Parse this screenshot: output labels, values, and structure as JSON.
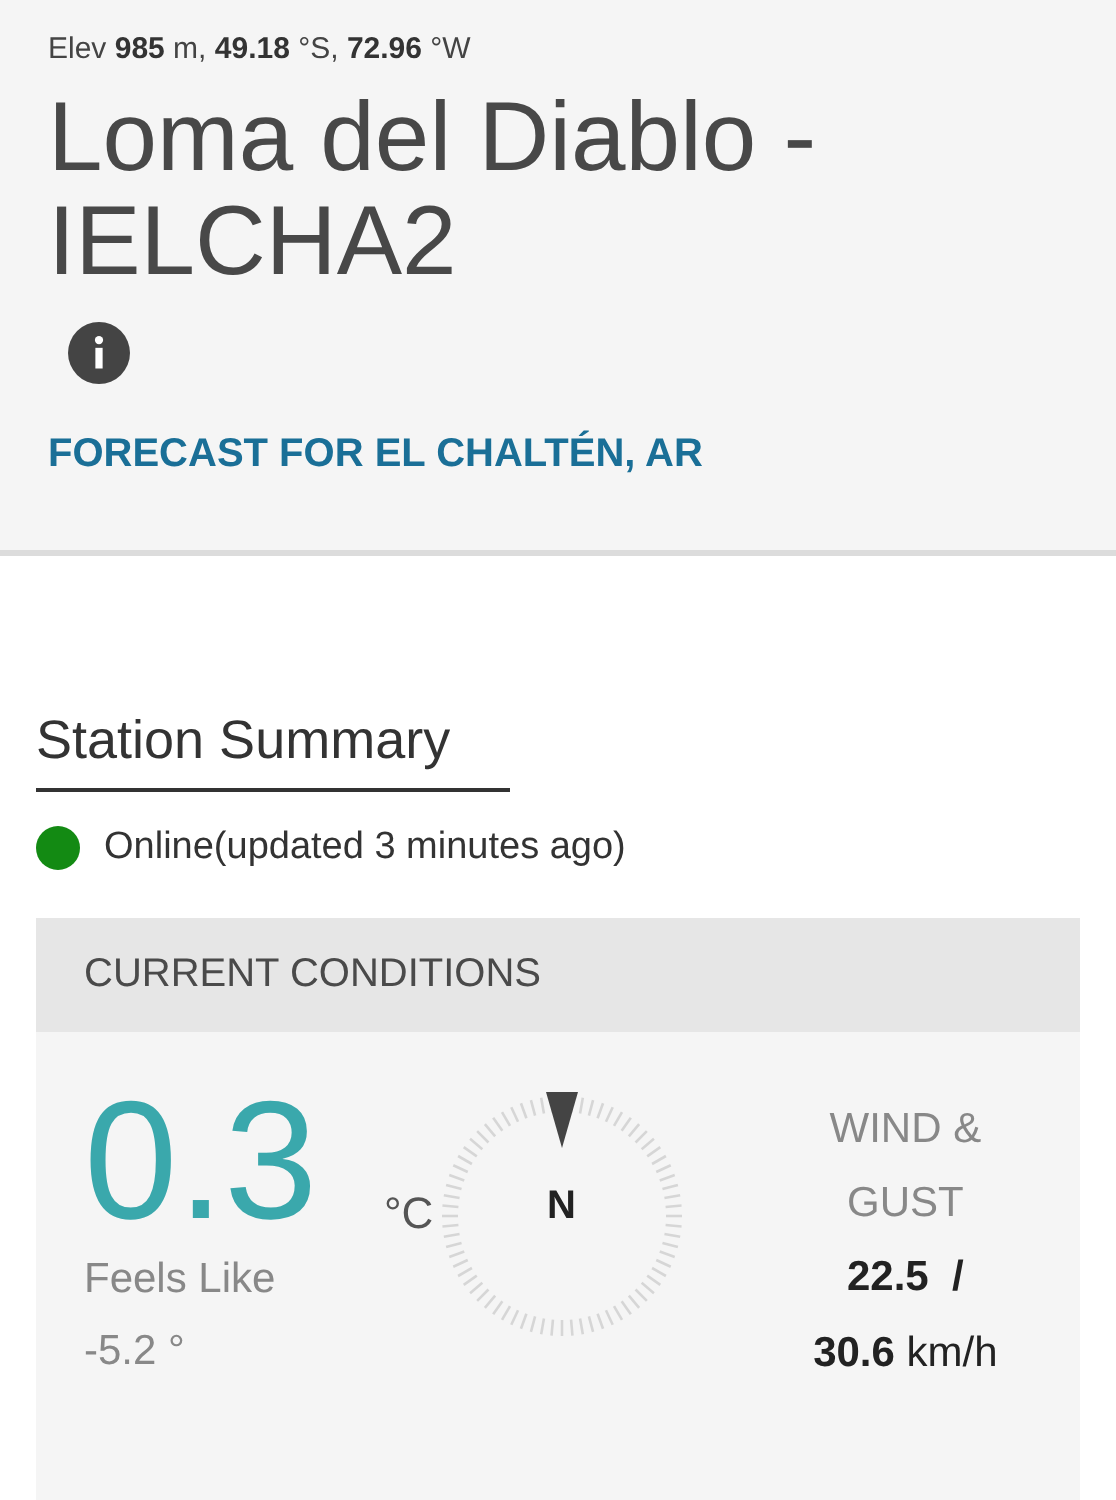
{
  "header": {
    "coordinates": "Elev **985** m, **49.18** °S, **72.96** °W",
    "station_name": "Loma del Diablo - IELCHA2",
    "forecast_link": "FORECAST FOR EL CHALTÉN, AR"
  },
  "summary": {
    "title": "Station Summary",
    "status": {
      "text": "Online(updated 3 minutes ago)",
      "color": "#138a13"
    }
  },
  "current_conditions": {
    "title": "CURRENT CONDITIONS",
    "temperature": "0.3",
    "unit": "°C",
    "feels_like_label": "Feels Like",
    "feels_like": "-5.2 °",
    "compass_label": "N",
    "wind_label": "WIND & GUST",
    "wind_speed": "22.5  /",
    "gust_speed": "**30.6** km/h"
  }
}
